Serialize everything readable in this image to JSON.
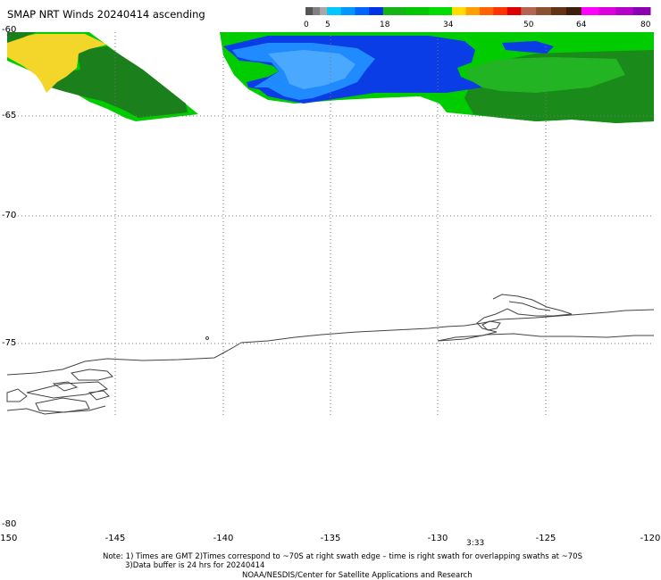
{
  "title": "SMAP NRT Winds 20240414 ascending",
  "colorbar": {
    "tick_labels": [
      "0",
      "5",
      "18",
      "34",
      "50",
      "64",
      "80"
    ],
    "segments": [
      {
        "from": 0,
        "to": 5,
        "colors": [
          "#555555",
          "#808080",
          "#a8a8a8"
        ]
      },
      {
        "from": 5,
        "to": 18,
        "colors": [
          "#00c8ff",
          "#0096ff",
          "#0064ff",
          "#0032e6"
        ]
      },
      {
        "from": 18,
        "to": 34,
        "colors": [
          "#14b414",
          "#00c800",
          "#00dc00"
        ]
      },
      {
        "from": 34,
        "to": 50,
        "colors": [
          "#ffdc00",
          "#ffa000",
          "#ff6400",
          "#ff3200",
          "#dc0000"
        ]
      },
      {
        "from": 50,
        "to": 64,
        "colors": [
          "#b46450",
          "#8c5032",
          "#643214",
          "#3c1e0a"
        ]
      },
      {
        "from": 64,
        "to": 80,
        "colors": [
          "#ff00ff",
          "#dc00dc",
          "#b400c8",
          "#8c00b4"
        ]
      }
    ]
  },
  "axes": {
    "lat_labels": [
      "-60",
      "-65",
      "-70",
      "-75",
      "-80"
    ],
    "lon_labels": [
      "-150",
      "-145",
      "-140",
      "-135",
      "-130",
      "-125",
      "-120"
    ]
  },
  "time_label": "3:33",
  "notes": {
    "line1": "Note: 1) Times are GMT 2)Times correspond to ~70S at right swath edge – time is right swath for overlapping swaths at ~70S",
    "line2": "3)Data buffer is 24 hrs for 20240414",
    "line3": "NOAA/NESDIS/Center for Satellite Applications and Research"
  }
}
